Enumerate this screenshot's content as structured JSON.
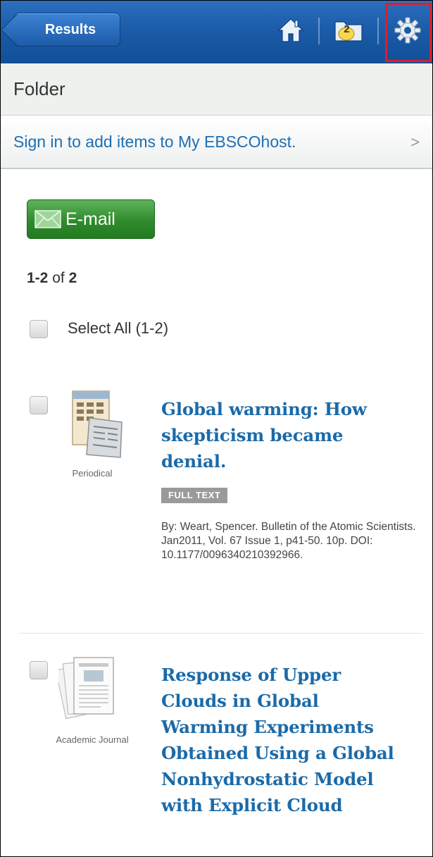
{
  "nav": {
    "back_label": "Results",
    "folder_count": "2"
  },
  "folder_header": {
    "title": "Folder"
  },
  "signin": {
    "text": "Sign in to add items to My EBSCOhost.",
    "chevron": ">"
  },
  "actions": {
    "email_label": "E-mail"
  },
  "pagination": {
    "range": "1-2",
    "of": "of",
    "total": "2"
  },
  "select_all": {
    "label": "Select All (1-2)"
  },
  "records": [
    {
      "type": "Periodical",
      "title": "Global warming: How skepticism became denial.",
      "badge": "FULL TEXT",
      "citation": "By: Weart, Spencer. Bulletin of the Atomic Scientists. Jan2011, Vol. 67 Issue 1, p41-50. 10p. DOI: 10.1177/0096340210392966."
    },
    {
      "type": "Academic Journal",
      "title": "Response of Upper Clouds in Global Warming Experiments Obtained Using a Global Nonhydrostatic Model with Explicit Cloud"
    }
  ],
  "colors": {
    "nav_blue": "#1a5aa6",
    "link_blue": "#1b6aa8",
    "email_green": "#2f8b2c",
    "badge_gray": "#9a9a9a",
    "highlight_red": "#d9202e"
  },
  "icons": [
    "home-icon",
    "folder-icon",
    "gear-icon",
    "envelope-icon",
    "periodical-icon",
    "journal-icon"
  ]
}
